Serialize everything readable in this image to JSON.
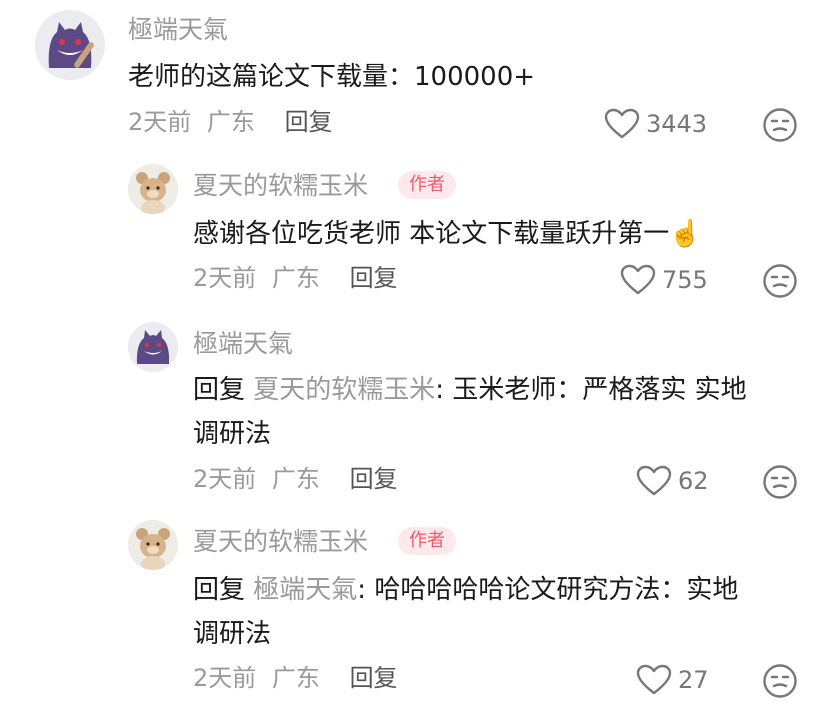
{
  "comments": [
    {
      "username": "極端天氣",
      "text": "老师的这篇论文下载量：100000+",
      "time": "2天前",
      "location": "广东",
      "reply_label": "回复",
      "likes": "3443"
    },
    {
      "username": "夏天的软糯玉米",
      "tag": "作者",
      "text": "感谢各位吃货老师 本论文下载量跃升第一☝️",
      "time": "2天前",
      "location": "广东",
      "reply_label": "回复",
      "likes": "755"
    },
    {
      "username": "極端天氣",
      "reply_prefix": "回复",
      "reply_target": "夏天的软糯玉米",
      "text_line1": ": 玉米老师：严格落实 实地",
      "text_line2": "调研法",
      "time": "2天前",
      "location": "广东",
      "reply_label": "回复",
      "likes": "62"
    },
    {
      "username": "夏天的软糯玉米",
      "tag": "作者",
      "reply_prefix": "回复",
      "reply_target": "極端天氣",
      "text_line1": ": 哈哈哈哈哈论文研究方法：实地",
      "text_line2": "调研法",
      "time": "2天前",
      "location": "广东",
      "reply_label": "回复",
      "likes": "27"
    }
  ],
  "colors": {
    "secondary_text": "#9a9a9a",
    "author_tag_text": "#f25a6e",
    "author_tag_bg": "#fde8eb"
  }
}
